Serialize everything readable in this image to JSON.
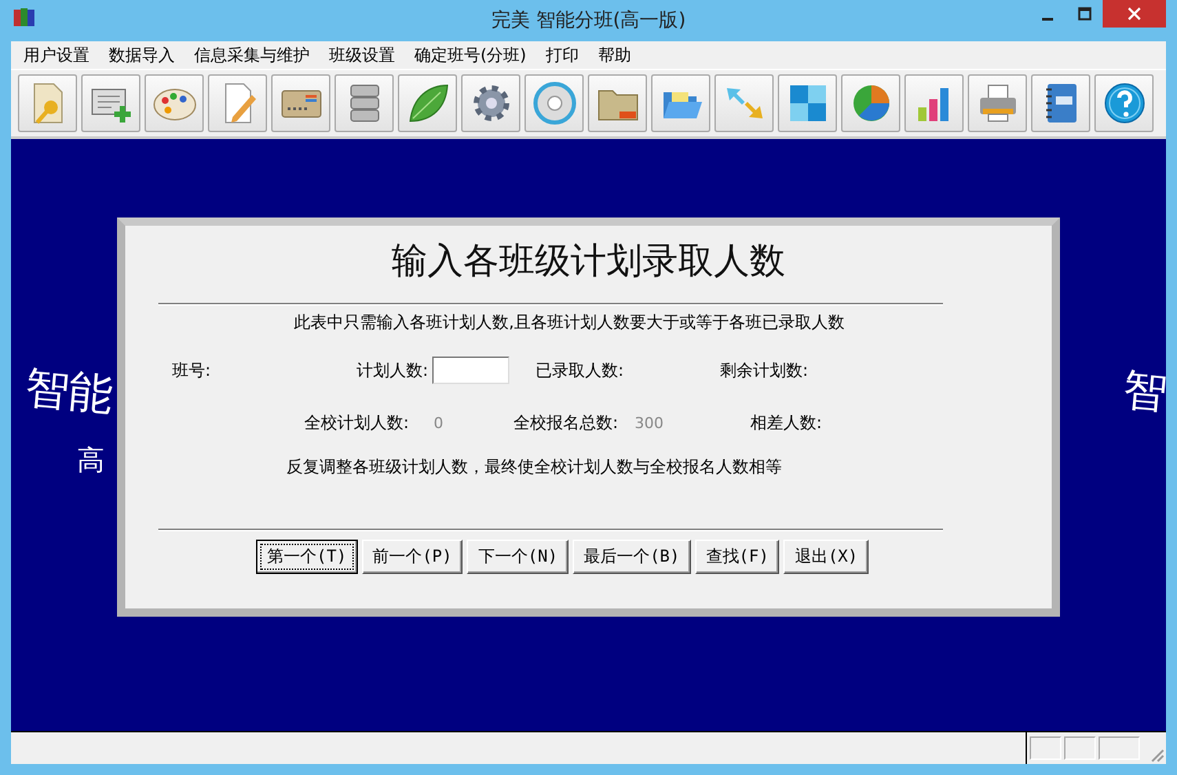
{
  "window": {
    "title": "完美 智能分班(高一版)"
  },
  "menu": [
    {
      "label": "用户设置"
    },
    {
      "label": "数据导入"
    },
    {
      "label": "信息采集与维护"
    },
    {
      "label": "班级设置"
    },
    {
      "label": "确定班号(分班)"
    },
    {
      "label": "打印"
    },
    {
      "label": "帮助"
    }
  ],
  "toolbar": [
    {
      "kind": "key"
    },
    {
      "kind": "cardadd"
    },
    {
      "kind": "palette"
    },
    {
      "kind": "pencil"
    },
    {
      "kind": "card"
    },
    {
      "kind": "server"
    },
    {
      "kind": "leaf"
    },
    {
      "kind": "gear"
    },
    {
      "kind": "disc"
    },
    {
      "kind": "folder"
    },
    {
      "kind": "openfolder"
    },
    {
      "kind": "arrows"
    },
    {
      "kind": "tiles"
    },
    {
      "kind": "pie"
    },
    {
      "kind": "bars"
    },
    {
      "kind": "printer"
    },
    {
      "kind": "notebook"
    },
    {
      "kind": "help"
    }
  ],
  "background": {
    "left_text": "智能",
    "left_subtext": "高",
    "right_text": "智"
  },
  "dialog": {
    "title": "输入各班级计划录取人数",
    "note": "此表中只需输入各班计划人数,且各班计划人数要大于或等于各班已录取人数",
    "class_label": "班号:",
    "plan_label": "计划人数:",
    "admitted_label": "已录取人数:",
    "remaining_label": "剩余计划数:",
    "school_plan_label": "全校计划人数:",
    "school_plan_value": "0",
    "applicants_label": "全校报名总数:",
    "applicants_value": "300",
    "difference_label": "相差人数:",
    "hint": "反复调整各班级计划人数，最终使全校计划人数与全校报名人数相等",
    "buttons": [
      {
        "label": "第一个(T)",
        "selected": true
      },
      {
        "label": "前一个(P)",
        "selected": false
      },
      {
        "label": "下一个(N)",
        "selected": false
      },
      {
        "label": "最后一个(B)",
        "selected": false
      },
      {
        "label": "查找(F)",
        "selected": false
      },
      {
        "label": "退出(X)",
        "selected": false
      }
    ]
  }
}
